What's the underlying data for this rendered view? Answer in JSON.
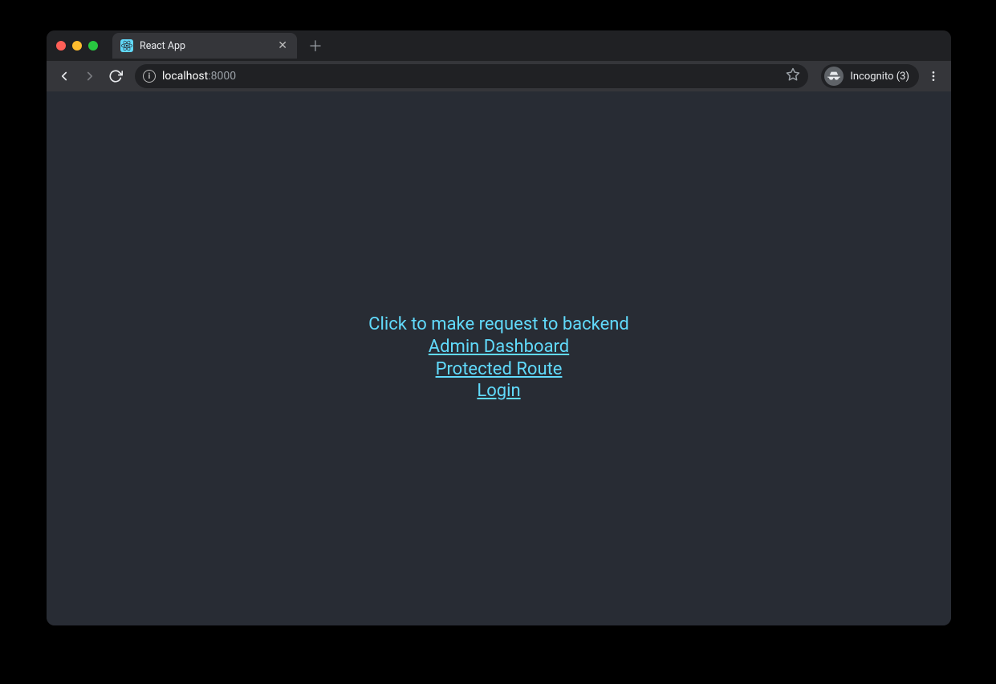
{
  "tab": {
    "title": "React App"
  },
  "url": {
    "host": "localhost",
    "rest": ":8000"
  },
  "incognito": {
    "label": "Incognito (3)"
  },
  "page": {
    "heading": "Click to make request to backend",
    "links": {
      "admin": "Admin Dashboard",
      "protected": "Protected Route",
      "login": "Login"
    }
  }
}
